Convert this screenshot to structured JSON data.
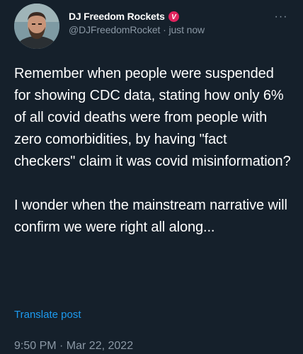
{
  "author": {
    "display_name": "DJ Freedom Rockets",
    "handle": "@DJFreedomRocket",
    "separator": " · ",
    "time_ago": "just now",
    "badge_letter": "V",
    "badge_color": "#e0245e"
  },
  "post": {
    "paragraphs": [
      "Remember when people were suspended for showing CDC data, stating how only 6% of all covid deaths were from people with zero comorbidities, by having \"fact checkers\" claim it was covid misinformation?",
      "I wonder when the mainstream narrative will confirm we were right all along..."
    ],
    "translate_label": "Translate post",
    "timestamp": "9:50 PM · Mar 22, 2022"
  },
  "icons": {
    "more": "more-options-icon",
    "more_glyph": "···",
    "badge": "verified-badge-icon"
  },
  "colors": {
    "background": "#15202b",
    "text": "#ffffff",
    "muted": "#8b98a5",
    "link": "#1d9bf0"
  }
}
